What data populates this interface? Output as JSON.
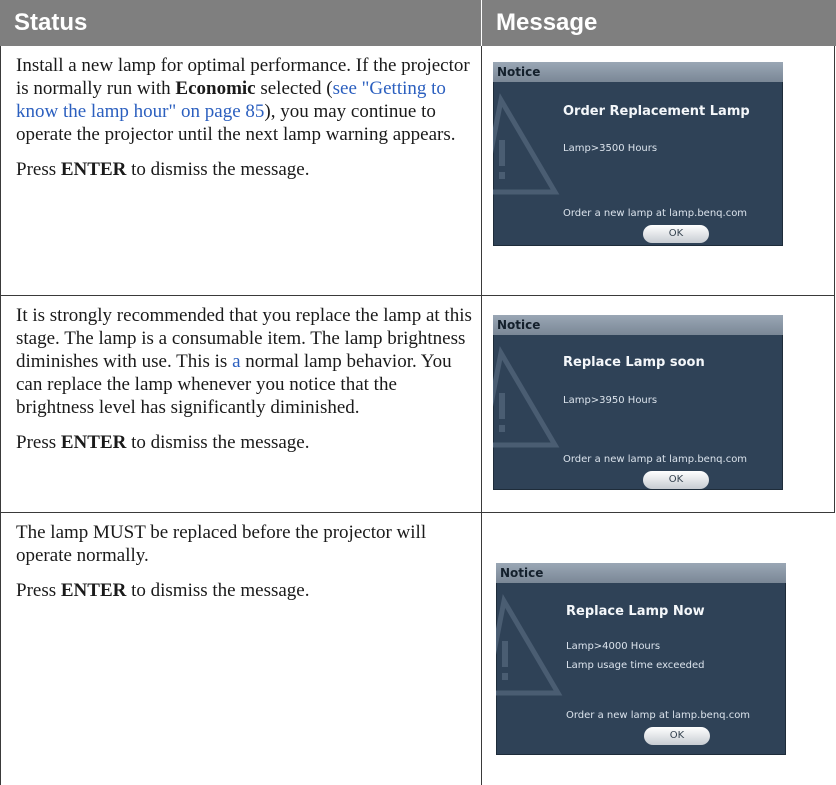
{
  "header": {
    "status": "Status",
    "message": "Message"
  },
  "rows": [
    {
      "status": {
        "p1_a": "Install a new lamp for optimal performance. If the projector is normally run with ",
        "p1_bold": "Economic",
        "p1_b": " selected (",
        "p1_link": "see \"Getting to know the lamp hour\" on page 85",
        "p1_c": "), you may continue to operate the projector until the next lamp warning appears.",
        "p2_a": "Press ",
        "p2_bold": "ENTER",
        "p2_b": " to dismiss the message."
      },
      "notice": {
        "bar": "Notice",
        "title": "Order Replacement Lamp",
        "line1": "Lamp>3500 Hours",
        "line2": "",
        "order": "Order a new lamp at lamp.benq.com",
        "ok": "OK"
      }
    },
    {
      "status": {
        "p1_a": "It is strongly recommended that you replace the lamp at this stage. The lamp is a consumable item. The lamp brightness diminishes with use. This is ",
        "p1_link": "a",
        "p1_c": " normal lamp behavior. You can replace the lamp whenever you notice that the brightness level has significantly diminished.",
        "p2_a": "Press ",
        "p2_bold": "ENTER",
        "p2_b": " to dismiss the message."
      },
      "notice": {
        "bar": "Notice",
        "title": "Replace Lamp soon",
        "line1": "Lamp>3950 Hours",
        "line2": "",
        "order": "Order a new lamp at lamp.benq.com",
        "ok": "OK"
      }
    },
    {
      "status": {
        "p1_a": "The lamp MUST be replaced before the projector will operate normally.",
        "p2_a": "Press ",
        "p2_bold": "ENTER",
        "p2_b": " to dismiss the message."
      },
      "notice": {
        "bar": "Notice",
        "title": "Replace Lamp Now",
        "line1": "Lamp>4000 Hours",
        "line2": "Lamp usage time exceeded",
        "order": "Order a new lamp at lamp.benq.com",
        "ok": "OK"
      }
    }
  ]
}
